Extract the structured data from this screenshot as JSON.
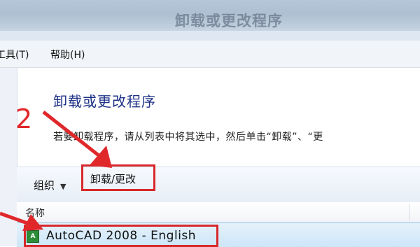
{
  "window": {
    "title": "卸载或更改程序"
  },
  "menubar": {
    "items": [
      {
        "label": "工具(T)"
      },
      {
        "label": "帮助(H)"
      }
    ]
  },
  "content": {
    "heading": "卸载或更改程序",
    "description": "若要卸载程序，请从列表中将其选中，然后单击“卸载”、“更"
  },
  "toolbar": {
    "organize_label": "组织",
    "organize_caret": "▼",
    "uninstall_change_label": "卸载/更改"
  },
  "list": {
    "columns": [
      {
        "label": "名称"
      }
    ],
    "rows": [
      {
        "name": "AutoCAD 2008 - English",
        "icon": "autocad-app-icon",
        "selected": true
      }
    ]
  },
  "annotations": {
    "step_label": "2",
    "color": "#e0282b"
  }
}
